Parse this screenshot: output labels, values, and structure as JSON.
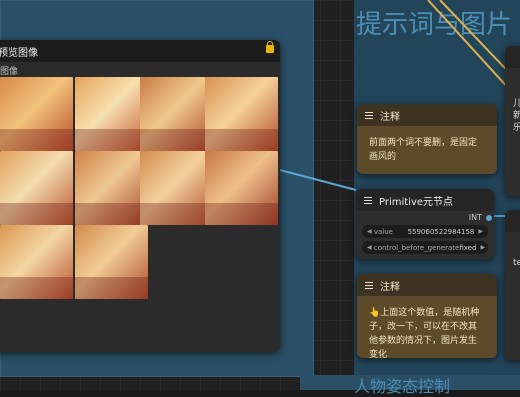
{
  "groups": {
    "top_title": "提示词与图片",
    "bottom_title": "人物姿态控制"
  },
  "preview_node": {
    "title": "预览图像",
    "output_label": "图像",
    "thumbnail_count": 10
  },
  "note_top": {
    "title": "注释",
    "text": "前面两个词不要删，是固定画风的"
  },
  "primitive_node": {
    "title": "Primitive元节点",
    "output_type": "INT",
    "widgets": [
      {
        "name": "value",
        "value": "559060522984158"
      },
      {
        "name": "control_before_generate",
        "value": "fixed"
      }
    ]
  },
  "note_bottom": {
    "title": "注释",
    "text": "👆上面这个数值，是随机种子，改一下，可以在不改其他参数的情况下，图片发生变化"
  },
  "right_node_top": {
    "snippet_lines": [
      "儿",
      "新",
      "乐"
    ]
  },
  "right_node_bottom": {
    "snippet": "te"
  },
  "colors": {
    "group_blue": "#2a4f66",
    "note_brown": "#5c4a2b",
    "link_blue": "#5aa7d0",
    "link_yellow": "#e0b050",
    "lock_yellow": "#e7b400"
  }
}
